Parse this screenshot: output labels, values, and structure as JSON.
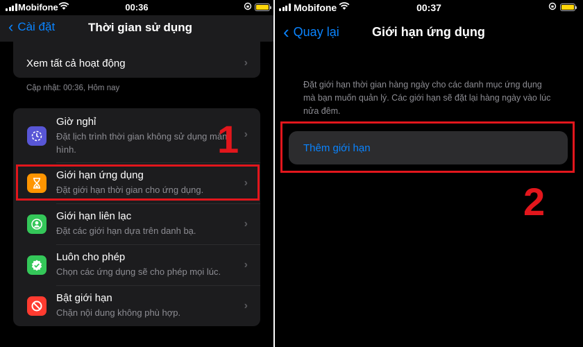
{
  "left": {
    "status": {
      "carrier": "Mobifone",
      "time": "00:36"
    },
    "nav": {
      "back_label": "Cài đặt",
      "title": "Thời gian sử dụng"
    },
    "see_all": "Xem tất cả hoạt động",
    "updated": "Cập nhật: 00:36, Hôm nay",
    "items": [
      {
        "title": "Giờ nghỉ",
        "subtitle": "Đặt lịch trình thời gian không sử dụng màn hình.",
        "icon": "downtime-icon",
        "color": "#5856d6"
      },
      {
        "title": "Giới hạn ứng dụng",
        "subtitle": "Đặt giới hạn thời gian cho ứng dụng.",
        "icon": "hourglass-icon",
        "color": "#ff9500"
      },
      {
        "title": "Giới hạn liên lạc",
        "subtitle": "Đặt các giới hạn dựa trên danh bạ.",
        "icon": "contact-icon",
        "color": "#34c759"
      },
      {
        "title": "Luôn cho phép",
        "subtitle": "Chọn các ứng dụng sẽ cho phép mọi lúc.",
        "icon": "checkmark-shield-icon",
        "color": "#34c759"
      },
      {
        "title": "Bật giới hạn",
        "subtitle": "Chặn nội dung không phù hợp.",
        "icon": "restriction-icon",
        "color": "#ff3b30"
      }
    ],
    "annotation": "1"
  },
  "right": {
    "status": {
      "carrier": "Mobifone",
      "time": "00:37"
    },
    "nav": {
      "back_label": "Quay lại",
      "title": "Giới hạn ứng dụng"
    },
    "description": "Đặt giới hạn thời gian hàng ngày cho các danh mục ứng dụng mà bạn muốn quản lý. Các giới hạn sẽ đặt lại hàng ngày vào lúc nửa đêm.",
    "add_limit": "Thêm giới hạn",
    "annotation": "2"
  },
  "colors": {
    "accent": "#0a84ff",
    "annotation": "#e2161c",
    "battery": "#ffd60a"
  }
}
